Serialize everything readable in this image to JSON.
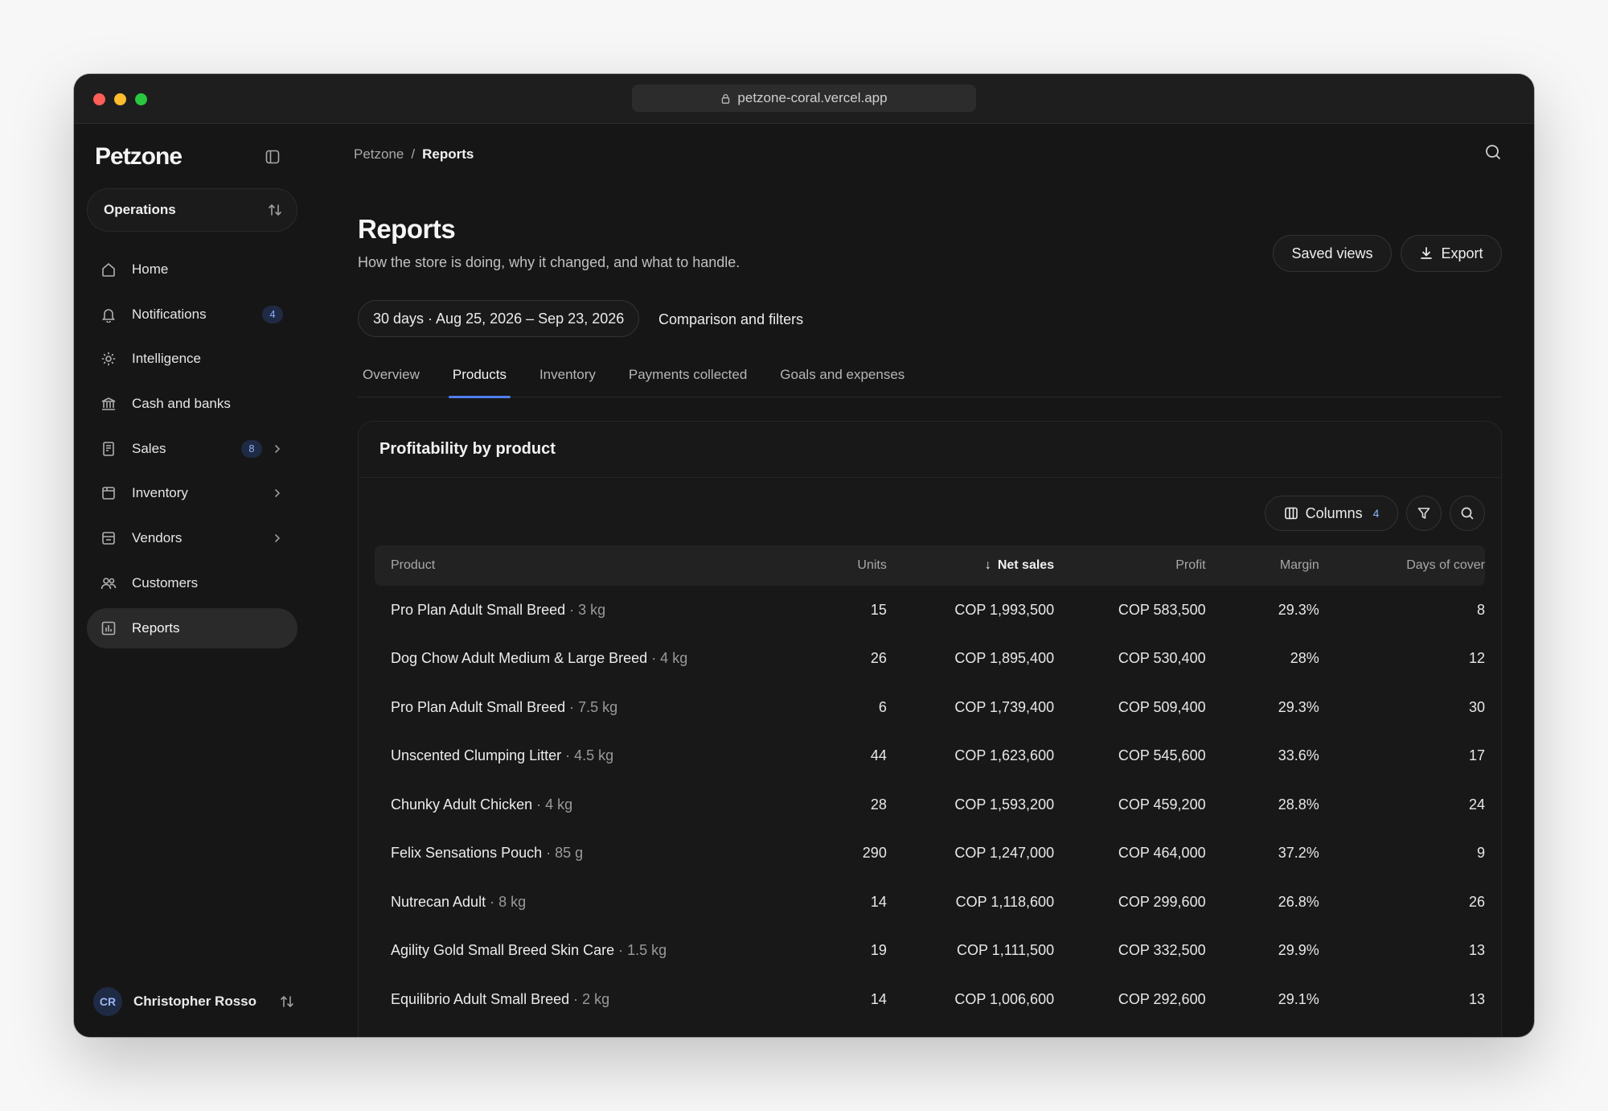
{
  "browser": {
    "url": "petzone-coral.vercel.app"
  },
  "sidebar": {
    "brand": "Petzone",
    "workspace": "Operations",
    "items": [
      {
        "label": "Home",
        "icon": "home-icon"
      },
      {
        "label": "Notifications",
        "icon": "bell-icon",
        "badge": "4"
      },
      {
        "label": "Intelligence",
        "icon": "gear-icon"
      },
      {
        "label": "Cash and banks",
        "icon": "bank-icon"
      },
      {
        "label": "Sales",
        "icon": "receipt-icon",
        "badge": "8"
      },
      {
        "label": "Inventory",
        "icon": "box-icon"
      },
      {
        "label": "Vendors",
        "icon": "store-icon"
      },
      {
        "label": "Customers",
        "icon": "users-icon"
      },
      {
        "label": "Reports",
        "icon": "chart-icon"
      }
    ],
    "user": {
      "initials": "CR",
      "name": "Christopher Rosso"
    }
  },
  "breadcrumb": {
    "root": "Petzone",
    "sep": "/",
    "current": "Reports"
  },
  "header": {
    "title": "Reports",
    "subtitle": "How the store is doing, why it changed, and what to handle.",
    "saved_views": "Saved views",
    "export": "Export"
  },
  "filters": {
    "range": "30 days · Aug 25, 2026 – Sep 23, 2026",
    "comparison": "Comparison and filters"
  },
  "tabs": [
    "Overview",
    "Products",
    "Inventory",
    "Payments collected",
    "Goals and expenses"
  ],
  "card": {
    "title": "Profitability by product",
    "columns_label": "Columns",
    "columns_count": "4"
  },
  "table": {
    "headers": {
      "product": "Product",
      "units": "Units",
      "net_sales": "Net sales",
      "profit": "Profit",
      "margin": "Margin",
      "days": "Days of cover"
    },
    "rows": [
      {
        "name": "Pro Plan Adult Small Breed",
        "size": " · 3 kg",
        "units": "15",
        "net": "COP 1,993,500",
        "profit": "COP 583,500",
        "margin": "29.3%",
        "days": "8"
      },
      {
        "name": "Dog Chow Adult Medium & Large Breed",
        "size": " · 4 kg",
        "units": "26",
        "net": "COP 1,895,400",
        "profit": "COP 530,400",
        "margin": "28%",
        "days": "12"
      },
      {
        "name": "Pro Plan Adult Small Breed",
        "size": " · 7.5 kg",
        "units": "6",
        "net": "COP 1,739,400",
        "profit": "COP 509,400",
        "margin": "29.3%",
        "days": "30"
      },
      {
        "name": "Unscented Clumping Litter",
        "size": " · 4.5 kg",
        "units": "44",
        "net": "COP 1,623,600",
        "profit": "COP 545,600",
        "margin": "33.6%",
        "days": "17"
      },
      {
        "name": "Chunky Adult Chicken",
        "size": " · 4 kg",
        "units": "28",
        "net": "COP 1,593,200",
        "profit": "COP 459,200",
        "margin": "28.8%",
        "days": "24"
      },
      {
        "name": "Felix Sensations Pouch",
        "size": " · 85 g",
        "units": "290",
        "net": "COP 1,247,000",
        "profit": "COP 464,000",
        "margin": "37.2%",
        "days": "9"
      },
      {
        "name": "Nutrecan Adult",
        "size": " · 8 kg",
        "units": "14",
        "net": "COP 1,118,600",
        "profit": "COP 299,600",
        "margin": "26.8%",
        "days": "26"
      },
      {
        "name": "Agility Gold Small Breed Skin Care",
        "size": " · 1.5 kg",
        "units": "19",
        "net": "COP 1,111,500",
        "profit": "COP 332,500",
        "margin": "29.9%",
        "days": "13"
      },
      {
        "name": "Equilibrio Adult Small Breed",
        "size": " · 2 kg",
        "units": "14",
        "net": "COP 1,006,600",
        "profit": "COP 292,600",
        "margin": "29.1%",
        "days": "13"
      }
    ]
  }
}
